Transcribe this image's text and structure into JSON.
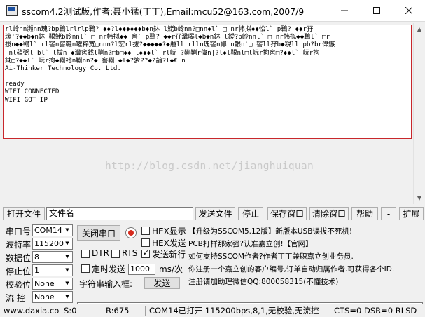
{
  "window": {
    "title": "sscom4.2测试版,作者:聂小猛(丁丁),Email:mcu52@163.com,2007/9",
    "icon": "sscom-app-icon",
    "controls": [
      "minimize-icon",
      "maximize-icon",
      "close-icon"
    ]
  },
  "receive": {
    "garbled_lines": [
      "rl岭nn瀕nn瑰?bp鶤lrlrlp鶤? ◆◆?l◆◆◆◆◆◆b◆n鈢 l鮱b岭nn?□nn◆l` □ nr帏拟◆◆忪l` p鶤? ◆◆r孖",
      "瑰'?◆◆b◆n鈢 鞎鮱b岭nnl` □ nr帏拟◆◆ 窖` p鶤? ◆◆r孖瀵嚗l◆b◆n鈢 l鑀?b岭nnl` □ nr帏拟◆◆鶤l` □r",
      "拔n◆◆鶤l` rl窖n窖鞋n罐粹宽□nnn?l宏rl拔?◆◆◆◆◆?◆䴡ll rlln瑰窖n鄮 n鞎n`□ 窖ll孖b◆粯ll pb?br偉鏃",
      " nl蕴弻l bl` l拔n ◆瀵窖鈛l鞩n?□b□◆◆ l◆◆◆l` rl岏 ?鞩鞩r偉n|?l◆l鞎nl□l岏r拘窖□?◆◆l` 岏r拘",
      "鈂□?◆◆l` 岏r拘◆鞩衪n鞩nn?◆ 窖鞩 ◆l◆?箩??◆?韽?l◆€ n"
    ],
    "vendor_line": "Ai-Thinker Technology Co. Ltd.",
    "messages": [
      "ready",
      "WIFI CONNECTED",
      "WIFI GOT IP"
    ]
  },
  "watermark": "http://blog.csdn.net/jianghuiquan",
  "toolbar": {
    "open_file": "打开文件",
    "file_name": "文件名",
    "send_file": "发送文件",
    "stop": "停止",
    "save_window": "保存窗口",
    "clear_window": "清除窗口",
    "help": "帮助",
    "collapse": "-",
    "expand": "扩展"
  },
  "settings": {
    "port_label": "串口号",
    "port_value": "COM14",
    "baud_label": "波特率",
    "baud_value": "115200",
    "databits_label": "数据位",
    "databits_value": "8",
    "stopbits_label": "停止位",
    "stopbits_value": "1",
    "parity_label": "校验位",
    "parity_value": "None",
    "flow_label": "流 控",
    "flow_value": "None",
    "close_port": "关闭串口",
    "hex_display": "HEX显示",
    "hex_send": "HEX发送",
    "send_newline": "发送新行",
    "dtr": "DTR",
    "rts": "RTS",
    "timed_send": "定时发送",
    "interval_value": "1000",
    "interval_unit": "ms/次",
    "char_input_label": "字符串输入框:",
    "send": "发送",
    "send_input_value": ""
  },
  "info": {
    "line1": "【升级为SSCOM5.12版】新版本USB误拔不死机!",
    "line2": "PCB打样那家强?认准嘉立创!【官网】",
    "line3": "如何支持SSCOM作者?作者丁丁兼职嘉立创业务员.",
    "line4": "你注册一个嘉立创的客户编号,订单自动归属作者.可获得各个ID.",
    "line5": "注册请加助理微信QQ:800058315(不懂技术)"
  },
  "status": {
    "website": "www.daxia.com",
    "sent": "S:0",
    "received": "R:675",
    "port_info": "COM14已打开  115200bps,8,1,无校验,无流控",
    "lines": "CTS=0 DSR=0 RLSD"
  },
  "colors": {
    "receive_border": "#c8272c",
    "watermark": "#c9c9c9",
    "led": "#d62b1e",
    "window_bg": "#f0f0f0"
  }
}
